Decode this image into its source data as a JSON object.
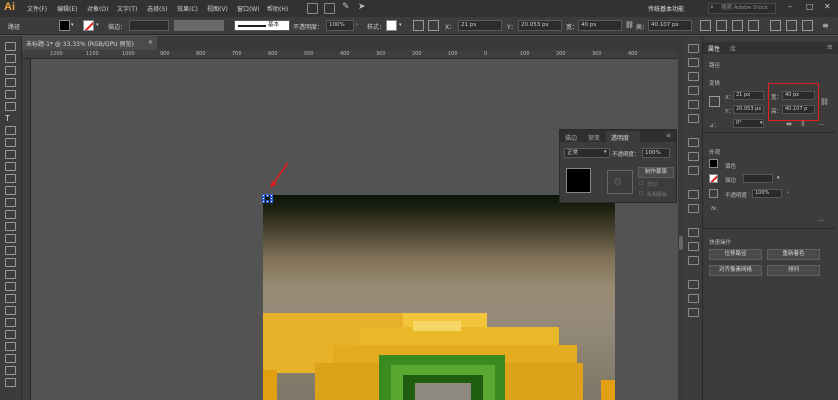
{
  "app": {
    "logo": "Ai"
  },
  "menu": [
    "文件(F)",
    "编辑(E)",
    "对象(O)",
    "文字(T)",
    "选择(S)",
    "效果(C)",
    "视图(V)",
    "窗口(W)",
    "帮助(H)"
  ],
  "workspace": {
    "label": "传统基本功能",
    "search_placeholder": "搜索 Adobe Stock"
  },
  "control_bar": {
    "selection_label": "路径",
    "stroke_label": "描边：",
    "stroke_style": "基本",
    "opacity_label": "不透明度：",
    "opacity_value": "100%",
    "style_label": "样式：",
    "x_label": "X：",
    "x_value": "21 px",
    "y_label": "Y：",
    "y_value": "20.053 px",
    "w_label": "宽：",
    "w_value": "40 px",
    "h_label": "高：",
    "h_value": "40.107 px"
  },
  "document": {
    "tab_label": "未标题-1* @ 33.33% (RGB/GPU 预览)"
  },
  "ruler": {
    "h_ticks": [
      "1200",
      "1100",
      "1000",
      "900",
      "800",
      "700",
      "600",
      "500",
      "400",
      "300",
      "200",
      "100",
      "0",
      "100",
      "200",
      "300",
      "400"
    ]
  },
  "transparency_panel": {
    "tabs": [
      "描边",
      "渐变",
      "透明度"
    ],
    "blend_mode": "正常",
    "opacity_label": "不透明度：",
    "opacity_value": "100%",
    "make_mask_button": "制作蒙版",
    "clip_label": "剪切",
    "invert_label": "反相蒙版"
  },
  "properties_panel": {
    "tabs": [
      "属性",
      "库"
    ],
    "path_label": "路径",
    "transform_label": "变换",
    "x_label": "X：",
    "x_value": "21 px",
    "y_label": "Y：",
    "y_value": "20.053 px",
    "w_label": "宽：",
    "w_value": "40 px",
    "h_label": "高：",
    "h_value": "40.107 p",
    "angle_label": "⊿：",
    "angle_value": "0°",
    "appearance_label": "外观",
    "fill_label": "填色",
    "stroke_label": "描边",
    "opacity_label": "不透明度",
    "opacity_value": "100%",
    "fx_label": "fx.",
    "quick_actions_label": "快速操作",
    "offset_path_button": "位移路径",
    "recolor_button": "重新着色",
    "align_pixel_button": "对齐像素网格",
    "arrange_button": "排列"
  },
  "colors": {
    "accent_red": "#e02020",
    "selection_blue": "#2a5bd7",
    "logo_orange": "#e8a33a"
  }
}
